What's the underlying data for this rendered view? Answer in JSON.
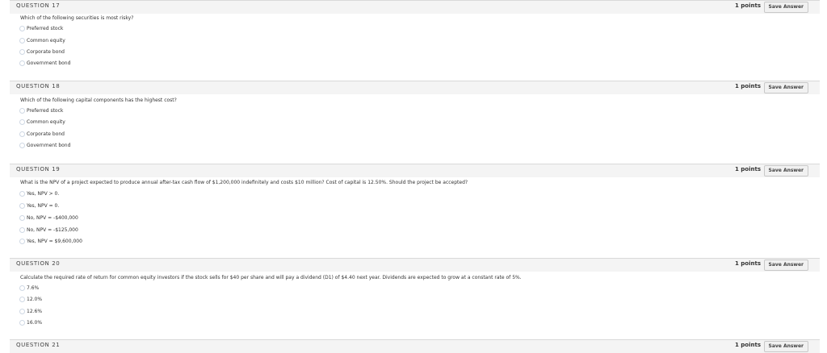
{
  "questions": [
    {
      "number": "QUESTION 17",
      "points": "1 points",
      "save_label": "Save Answer",
      "text": "Which of the following securities is most risky?",
      "options": [
        "Preferred stock",
        "Common equity",
        "Corporate bond",
        "Government bond"
      ]
    },
    {
      "number": "QUESTION 18",
      "points": "1 points",
      "save_label": "Save Answer",
      "text": "Which of the following capital components has the highest cost?",
      "options": [
        "Preferred stock",
        "Common equity",
        "Corporate bond",
        "Government bond"
      ]
    },
    {
      "number": "QUESTION 19",
      "points": "1 points",
      "save_label": "Save Answer",
      "text": "What is the NPV of a project expected to produce annual after-tax cash flow of $1,200,000 indefinitely and costs $10 million? Cost of capital is 12.50%. Should the project be accepted?",
      "options": [
        "Yes, NPV > 0.",
        "Yes, NPV = 0.",
        "No, NPV = -$400,000",
        "No, NPV = -$125,000",
        "Yes, NPV = $9,600,000"
      ]
    },
    {
      "number": "QUESTION 20",
      "points": "1 points",
      "save_label": "Save Answer",
      "text": "Calculate the required rate of return for common equity investors if the stock sells for $40 per share and will pay a dividend (D1) of $4.40 next year. Dividends are expected to grow at a constant rate of 5%.",
      "options": [
        "7.6%",
        "12.0%",
        "12.6%",
        "16.0%"
      ]
    },
    {
      "number": "QUESTION 21",
      "points": "1 points",
      "save_label": "Save Answer",
      "text": "",
      "options": []
    }
  ]
}
